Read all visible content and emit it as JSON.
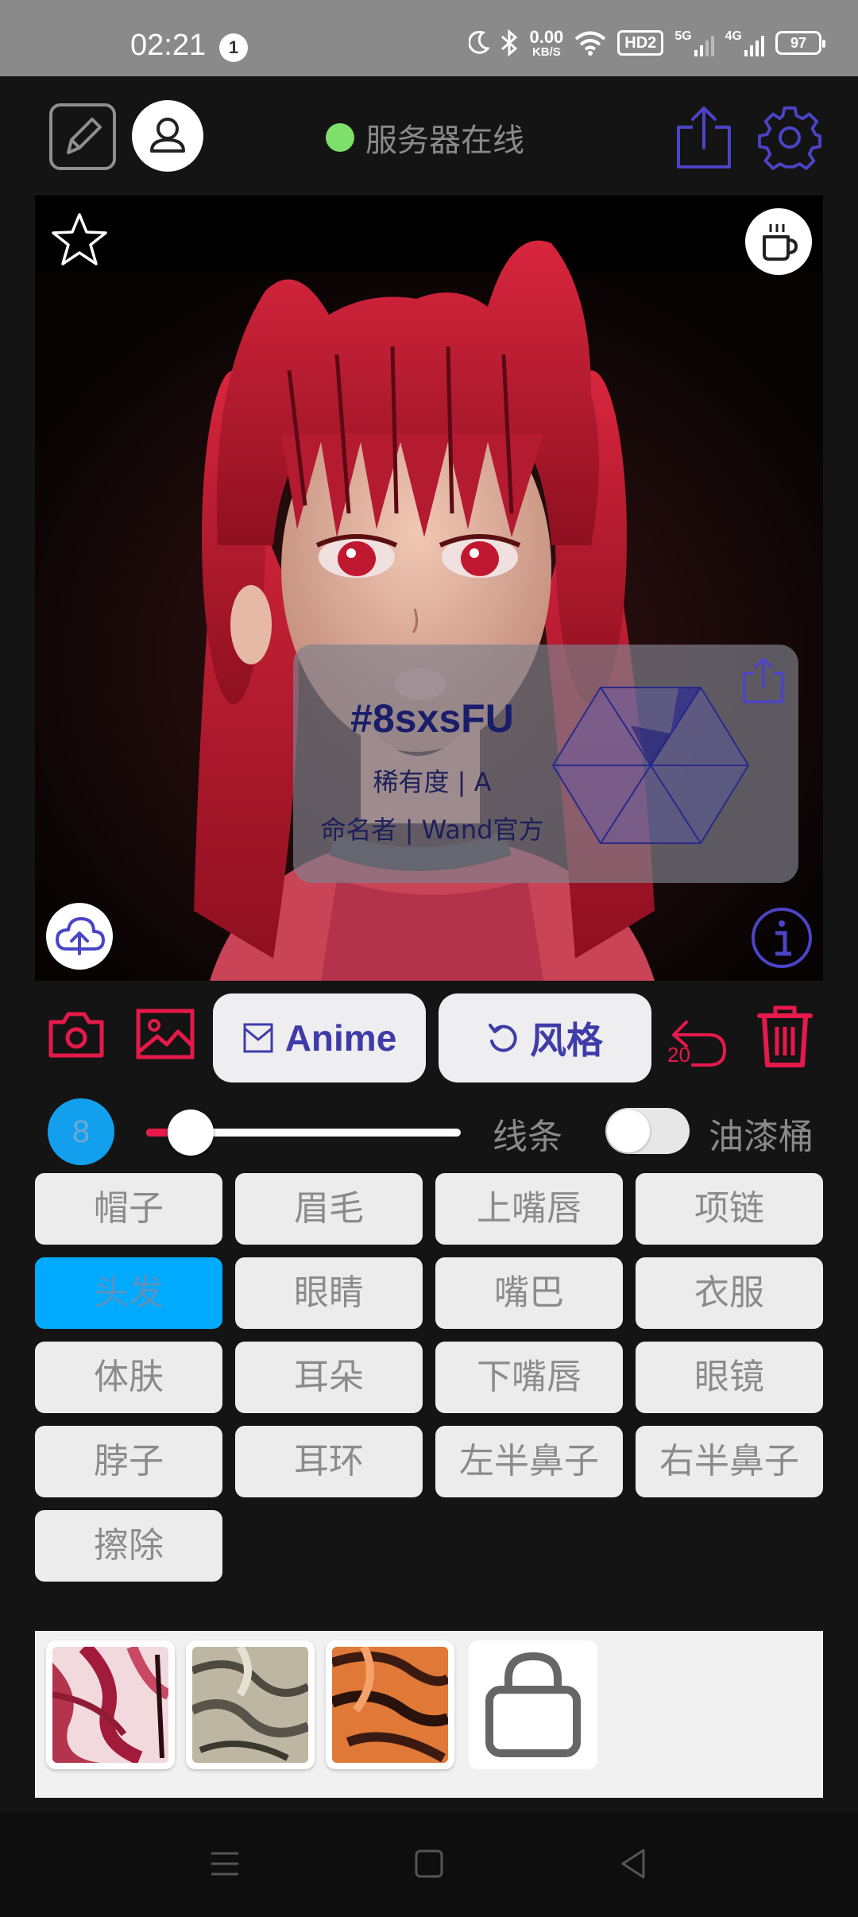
{
  "status_bar": {
    "time": "02:21",
    "notification_count": "1",
    "net_speed_value": "0.00",
    "net_speed_unit": "KB/S",
    "hd_label": "HD2",
    "sim1_label": "5G",
    "sim2_label": "4G",
    "battery": "97"
  },
  "header": {
    "server_status": "服务器在线",
    "server_status_color": "#7ee06a",
    "accent_color": "#4b44c7"
  },
  "card": {
    "code": "#8sxsFU",
    "rarity": "稀有度 | A",
    "namer": "命名者 | Wand官方"
  },
  "toolbar": {
    "anime_label": "Anime",
    "style_label": "风格",
    "undo_count": "20"
  },
  "brush": {
    "size": "8",
    "slider_fraction": 0.08,
    "line_label": "线条",
    "bucket_label": "油漆桶",
    "bucket_enabled": false
  },
  "parts": [
    {
      "label": "帽子",
      "active": false
    },
    {
      "label": "眉毛",
      "active": false
    },
    {
      "label": "上嘴唇",
      "active": false
    },
    {
      "label": "项链",
      "active": false
    },
    {
      "label": "头发",
      "active": true
    },
    {
      "label": "眼睛",
      "active": false
    },
    {
      "label": "嘴巴",
      "active": false
    },
    {
      "label": "衣服",
      "active": false
    },
    {
      "label": "体肤",
      "active": false
    },
    {
      "label": "耳朵",
      "active": false
    },
    {
      "label": "下嘴唇",
      "active": false
    },
    {
      "label": "眼镜",
      "active": false
    },
    {
      "label": "脖子",
      "active": false
    },
    {
      "label": "耳环",
      "active": false
    },
    {
      "label": "左半鼻子",
      "active": false
    },
    {
      "label": "右半鼻子",
      "active": false
    },
    {
      "label": "擦除",
      "active": false
    }
  ],
  "textures": [
    {
      "name": "texture-pink"
    },
    {
      "name": "texture-gray"
    },
    {
      "name": "texture-orange"
    },
    {
      "name": "lock-icon"
    }
  ]
}
